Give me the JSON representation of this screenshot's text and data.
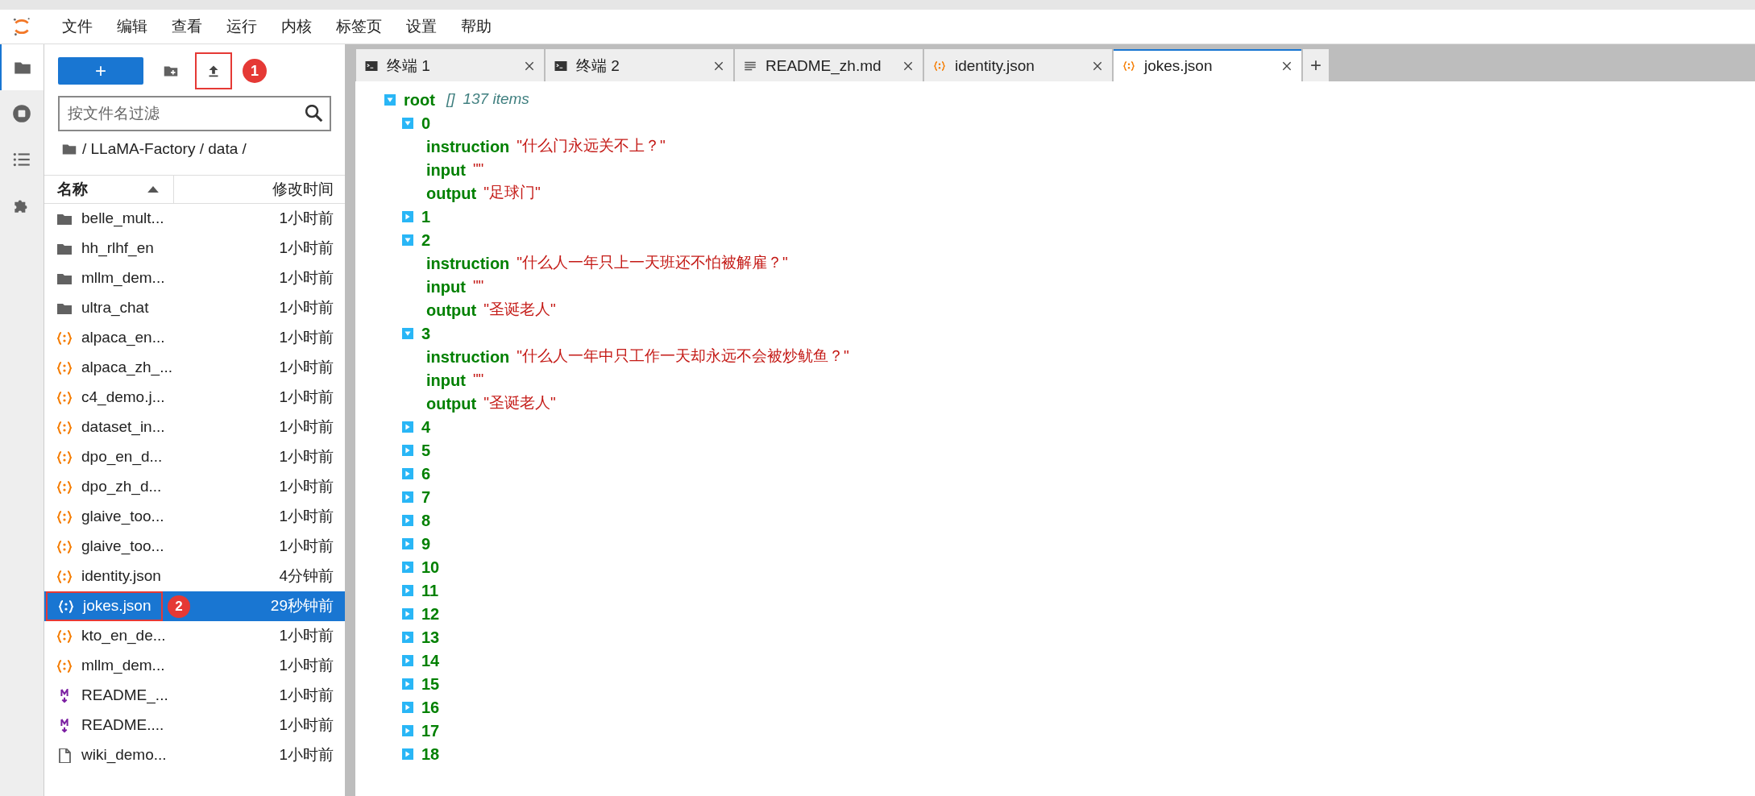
{
  "menu": [
    "文件",
    "编辑",
    "查看",
    "运行",
    "内核",
    "标签页",
    "设置",
    "帮助"
  ],
  "activity_bar": [
    {
      "kind": "folder",
      "selected": true
    },
    {
      "kind": "stop",
      "selected": false
    },
    {
      "kind": "list",
      "selected": false
    },
    {
      "kind": "puzzle",
      "selected": false
    }
  ],
  "file_browser": {
    "toolbar": [
      {
        "kind": "new",
        "label": "+"
      },
      {
        "kind": "new_folder"
      },
      {
        "kind": "upload",
        "annotation": "1"
      }
    ],
    "filter": {
      "placeholder": "按文件名过滤"
    },
    "breadcrumb": "/ LLaMA-Factory / data /",
    "columns": [
      {
        "label": "名称",
        "sorted": true
      },
      {
        "label": "修改时间",
        "sorted": false
      }
    ],
    "files": [
      {
        "name": "belle_mult...",
        "modified": "1小时前",
        "kind": "folder",
        "selected": false
      },
      {
        "name": "hh_rlhf_en",
        "modified": "1小时前",
        "kind": "folder",
        "selected": false
      },
      {
        "name": "mllm_dem...",
        "modified": "1小时前",
        "kind": "folder",
        "selected": false
      },
      {
        "name": "ultra_chat",
        "modified": "1小时前",
        "kind": "folder",
        "selected": false
      },
      {
        "name": "alpaca_en...",
        "modified": "1小时前",
        "kind": "json",
        "selected": false
      },
      {
        "name": "alpaca_zh_...",
        "modified": "1小时前",
        "kind": "json",
        "selected": false
      },
      {
        "name": "c4_demo.j...",
        "modified": "1小时前",
        "kind": "json",
        "selected": false
      },
      {
        "name": "dataset_in...",
        "modified": "1小时前",
        "kind": "json",
        "selected": false
      },
      {
        "name": "dpo_en_d...",
        "modified": "1小时前",
        "kind": "json",
        "selected": false
      },
      {
        "name": "dpo_zh_d...",
        "modified": "1小时前",
        "kind": "json",
        "selected": false
      },
      {
        "name": "glaive_too...",
        "modified": "1小时前",
        "kind": "json",
        "selected": false
      },
      {
        "name": "glaive_too...",
        "modified": "1小时前",
        "kind": "json",
        "selected": false
      },
      {
        "name": "identity.json",
        "modified": "4分钟前",
        "kind": "json",
        "selected": false
      },
      {
        "name": "jokes.json",
        "modified": "29秒钟前",
        "kind": "json",
        "selected": true,
        "annotation": "2"
      },
      {
        "name": "kto_en_de...",
        "modified": "1小时前",
        "kind": "json",
        "selected": false
      },
      {
        "name": "mllm_dem...",
        "modified": "1小时前",
        "kind": "json",
        "selected": false
      },
      {
        "name": "README_...",
        "modified": "1小时前",
        "kind": "markdown",
        "selected": false
      },
      {
        "name": "README....",
        "modified": "1小时前",
        "kind": "markdown",
        "selected": false
      },
      {
        "name": "wiki_demo...",
        "modified": "1小时前",
        "kind": "file",
        "selected": false
      }
    ]
  },
  "tabs": [
    {
      "label": "终端 1",
      "kind": "terminal",
      "selected": false
    },
    {
      "label": "终端 2",
      "kind": "terminal",
      "selected": false
    },
    {
      "label": "README_zh.md",
      "kind": "markdown",
      "selected": false
    },
    {
      "label": "identity.json",
      "kind": "json",
      "selected": false
    },
    {
      "label": "jokes.json",
      "kind": "json",
      "selected": true
    }
  ],
  "add_tab": "+",
  "tree": {
    "key": "root",
    "type_mark": "[]",
    "count": "137 items",
    "expanded": true,
    "children": [
      {
        "key": "0",
        "expanded": true,
        "children": [
          {
            "key": "instruction",
            "value": "\"什么门永远关不上？\""
          },
          {
            "key": "input",
            "value": "\"\""
          },
          {
            "key": "output",
            "value": "\"足球门\""
          }
        ]
      },
      {
        "key": "1",
        "expanded": false
      },
      {
        "key": "2",
        "expanded": true,
        "children": [
          {
            "key": "instruction",
            "value": "\"什么人一年只上一天班还不怕被解雇？\""
          },
          {
            "key": "input",
            "value": "\"\""
          },
          {
            "key": "output",
            "value": "\"圣诞老人\""
          }
        ]
      },
      {
        "key": "3",
        "expanded": true,
        "children": [
          {
            "key": "instruction",
            "value": "\"什么人一年中只工作一天却永远不会被炒鱿鱼？\""
          },
          {
            "key": "input",
            "value": "\"\""
          },
          {
            "key": "output",
            "value": "\"圣诞老人\""
          }
        ]
      },
      {
        "key": "4",
        "expanded": false
      },
      {
        "key": "5",
        "expanded": false
      },
      {
        "key": "6",
        "expanded": false
      },
      {
        "key": "7",
        "expanded": false
      },
      {
        "key": "8",
        "expanded": false
      },
      {
        "key": "9",
        "expanded": false
      },
      {
        "key": "10",
        "expanded": false
      },
      {
        "key": "11",
        "expanded": false
      },
      {
        "key": "12",
        "expanded": false
      },
      {
        "key": "13",
        "expanded": false
      },
      {
        "key": "14",
        "expanded": false
      },
      {
        "key": "15",
        "expanded": false
      },
      {
        "key": "16",
        "expanded": false
      },
      {
        "key": "17",
        "expanded": false
      },
      {
        "key": "18",
        "expanded": false
      }
    ]
  }
}
